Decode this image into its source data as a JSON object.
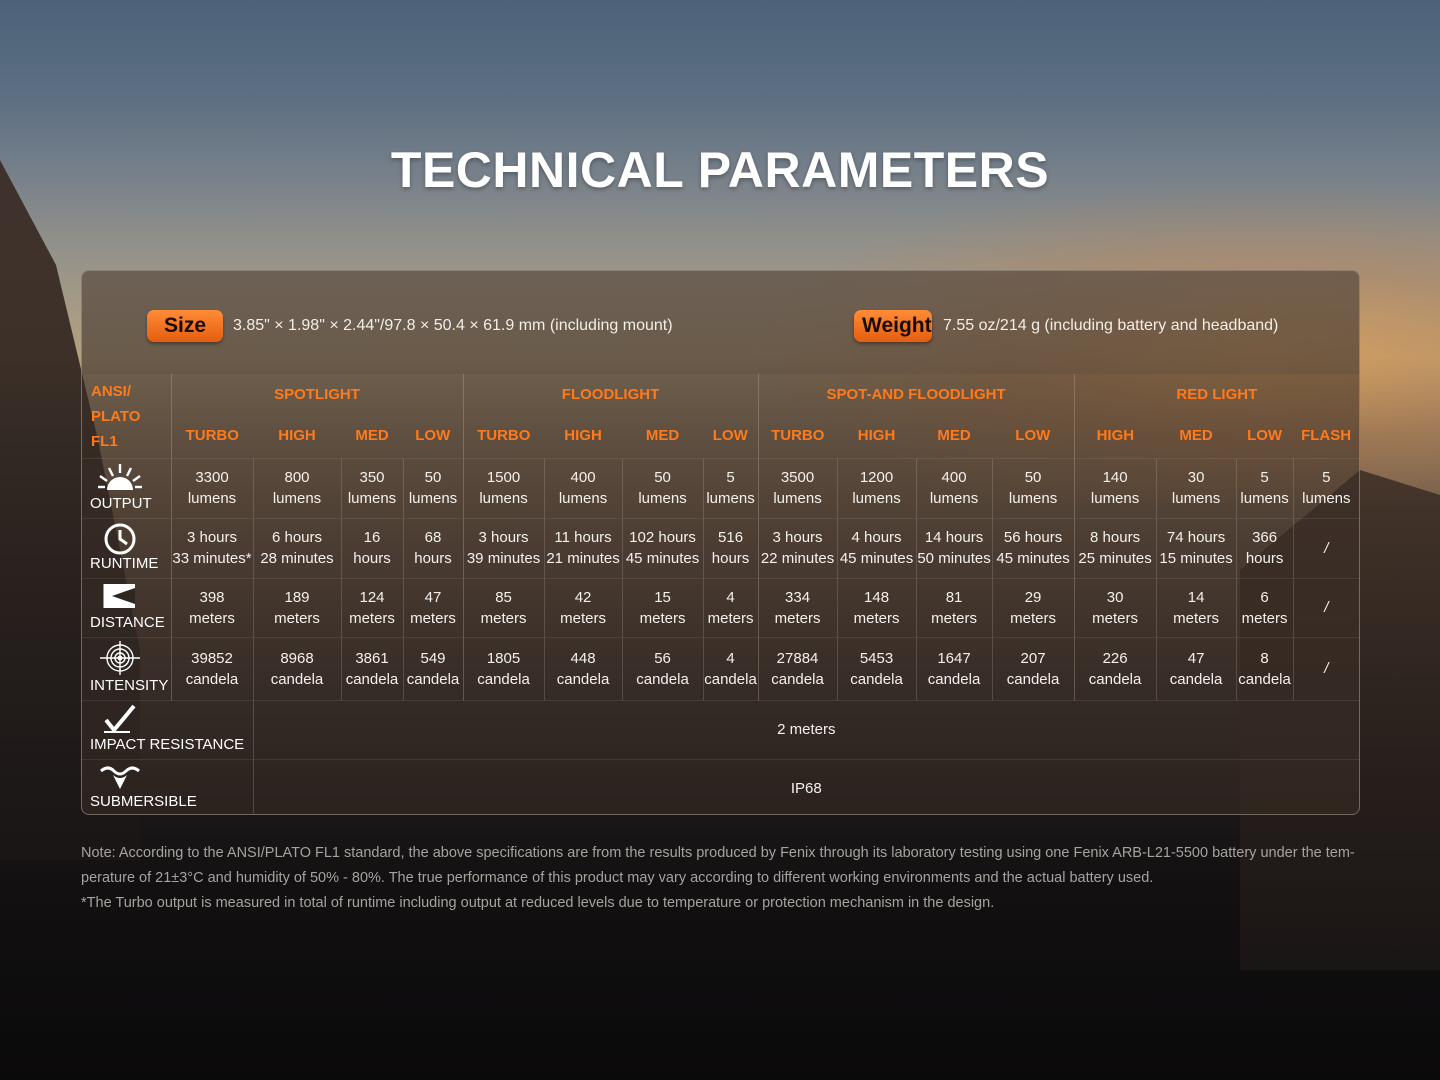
{
  "title": "TECHNICAL PARAMETERS",
  "size": {
    "label": "Size",
    "value": "3.85\" × 1.98\" × 2.44\"/97.8 × 50.4 × 61.9 mm (including mount)"
  },
  "weight": {
    "label": "Weight",
    "value": "7.55 oz/214 g (including battery and headband)"
  },
  "standard_label": [
    "ANSI/",
    "PLATO",
    "FL1"
  ],
  "groups": [
    "SPOTLIGHT",
    "FLOODLIGHT",
    "SPOT-AND FLOODLIGHT",
    "RED LIGHT"
  ],
  "modes": [
    "TURBO",
    "HIGH",
    "MED",
    "LOW",
    "TURBO",
    "HIGH",
    "MED",
    "LOW",
    "TURBO",
    "HIGH",
    "MED",
    "LOW",
    "HIGH",
    "MED",
    "LOW",
    "FLASH"
  ],
  "rows": {
    "output": {
      "label": "OUTPUT",
      "icon": "sun-burst-icon",
      "cells": [
        [
          "3300",
          "lumens"
        ],
        [
          "800",
          "lumens"
        ],
        [
          "350",
          "lumens"
        ],
        [
          "50",
          "lumens"
        ],
        [
          "1500",
          "lumens"
        ],
        [
          "400",
          "lumens"
        ],
        [
          "50",
          "lumens"
        ],
        [
          "5",
          "lumens"
        ],
        [
          "3500",
          "lumens"
        ],
        [
          "1200",
          "lumens"
        ],
        [
          "400",
          "lumens"
        ],
        [
          "50",
          "lumens"
        ],
        [
          "140",
          "lumens"
        ],
        [
          "30",
          "lumens"
        ],
        [
          "5",
          "lumens"
        ],
        [
          "5",
          "lumens"
        ]
      ]
    },
    "runtime": {
      "label": "RUNTIME",
      "icon": "clock-icon",
      "cells": [
        [
          "3 hours",
          "33 minutes*"
        ],
        [
          "6 hours",
          "28 minutes"
        ],
        [
          "16",
          "hours"
        ],
        [
          "68",
          "hours"
        ],
        [
          "3 hours",
          "39 minutes"
        ],
        [
          "11 hours",
          "21 minutes"
        ],
        [
          "102 hours",
          "45 minutes"
        ],
        [
          "516",
          "hours"
        ],
        [
          "3 hours",
          "22 minutes"
        ],
        [
          "4 hours",
          "45 minutes"
        ],
        [
          "14 hours",
          "50 minutes"
        ],
        [
          "56 hours",
          "45 minutes"
        ],
        [
          "8 hours",
          "25 minutes"
        ],
        [
          "74 hours",
          "15 minutes"
        ],
        [
          "366",
          "hours"
        ],
        [
          "/",
          ""
        ]
      ]
    },
    "distance": {
      "label": "DISTANCE",
      "icon": "beam-distance-icon",
      "cells": [
        [
          "398",
          "meters"
        ],
        [
          "189",
          "meters"
        ],
        [
          "124",
          "meters"
        ],
        [
          "47",
          "meters"
        ],
        [
          "85",
          "meters"
        ],
        [
          "42",
          "meters"
        ],
        [
          "15",
          "meters"
        ],
        [
          "4",
          "meters"
        ],
        [
          "334",
          "meters"
        ],
        [
          "148",
          "meters"
        ],
        [
          "81",
          "meters"
        ],
        [
          "29",
          "meters"
        ],
        [
          "30",
          "meters"
        ],
        [
          "14",
          "meters"
        ],
        [
          "6",
          "meters"
        ],
        [
          "/",
          ""
        ]
      ]
    },
    "intensity": {
      "label": "INTENSITY",
      "icon": "target-icon",
      "cells": [
        [
          "39852",
          "candela"
        ],
        [
          "8968",
          "candela"
        ],
        [
          "3861",
          "candela"
        ],
        [
          "549",
          "candela"
        ],
        [
          "1805",
          "candela"
        ],
        [
          "448",
          "candela"
        ],
        [
          "56",
          "candela"
        ],
        [
          "4",
          "candela"
        ],
        [
          "27884",
          "candela"
        ],
        [
          "5453",
          "candela"
        ],
        [
          "1647",
          "candela"
        ],
        [
          "207",
          "candela"
        ],
        [
          "226",
          "candela"
        ],
        [
          "47",
          "candela"
        ],
        [
          "8",
          "candela"
        ],
        [
          "/",
          ""
        ]
      ]
    },
    "impact": {
      "label": "IMPACT RESISTANCE",
      "icon": "impact-check-icon",
      "value": "2 meters"
    },
    "submersible": {
      "label": "SUBMERSIBLE",
      "icon": "water-drop-icon",
      "value": "IP68"
    }
  },
  "notes": [
    "Note: According to the ANSI/PLATO FL1 standard, the above specifications are from the results produced by Fenix through its laboratory testing using one Fenix ARB-L21-5500 battery under the tem-",
    "perature of 21±3°C and humidity of 50% - 80%. The true performance of this product may vary according to different working environments and the actual battery used.",
    "*The Turbo output is measured in total of runtime including output at reduced levels due to temperature or protection mechanism in the design."
  ],
  "colors": {
    "accent": "#ff7a1a",
    "pill_top": "#ff8c36",
    "pill_bottom": "#e45e10"
  }
}
